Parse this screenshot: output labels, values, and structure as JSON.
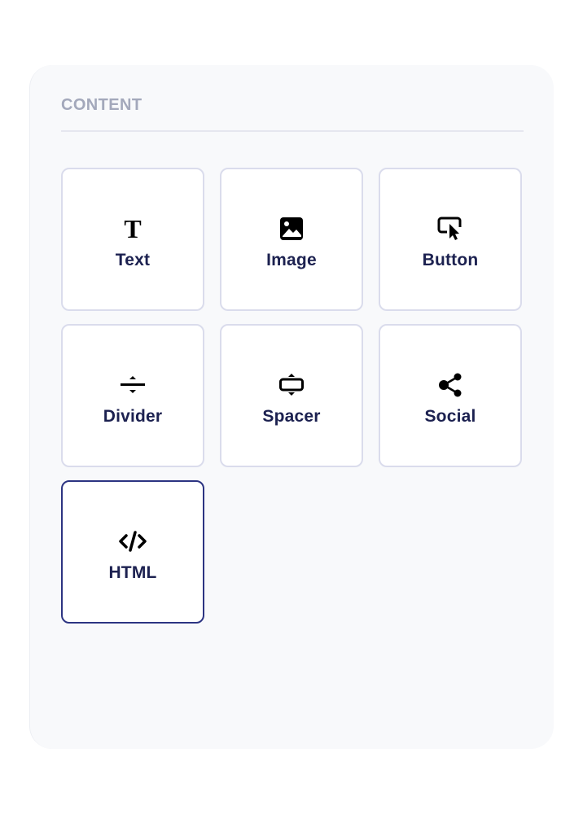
{
  "section": {
    "title": "CONTENT"
  },
  "blocks": [
    {
      "label": "Text",
      "icon": "text-icon"
    },
    {
      "label": "Image",
      "icon": "image-icon"
    },
    {
      "label": "Button",
      "icon": "button-icon"
    },
    {
      "label": "Divider",
      "icon": "divider-icon"
    },
    {
      "label": "Spacer",
      "icon": "spacer-icon"
    },
    {
      "label": "Social",
      "icon": "social-icon"
    },
    {
      "label": "HTML",
      "icon": "html-code-icon",
      "selected": true
    }
  ],
  "colors": {
    "panel_background": "#f8f9fb",
    "label_text": "#1c2150",
    "header_text": "#a3a8bb",
    "tile_border": "#dadcec",
    "selected_border": "#2c3482"
  }
}
